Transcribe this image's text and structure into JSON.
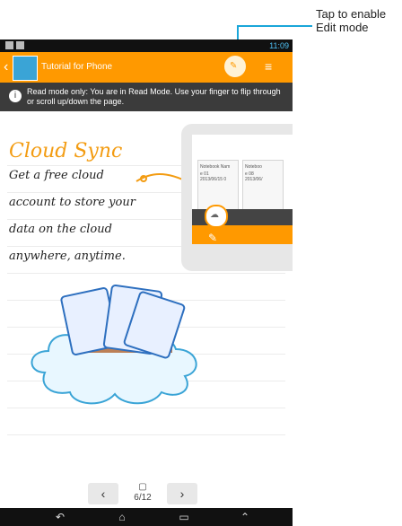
{
  "callout": {
    "text": "Tap to enable\nEdit mode"
  },
  "status_bar": {
    "time": "11:09"
  },
  "action_bar": {
    "title": "Tutorial for Phone"
  },
  "banner": {
    "text": "Read mode only: You are in Read Mode. Use your finger to flip through or scroll up/down the page."
  },
  "note": {
    "title": "Cloud Sync",
    "lines": [
      "Get a free cloud",
      "account to store your",
      "data on the cloud",
      "anywhere, anytime."
    ]
  },
  "card": {
    "notebook_1_title": "Notebook Nam",
    "notebook_1_meta": "e 01\n2013/06/15 0",
    "notebook_2_title": "Noteboo",
    "notebook_2_meta": "e 08\n2013/06/"
  },
  "pager": {
    "prev": "‹",
    "next": "›",
    "page": "6/12"
  },
  "nav": {
    "back_icon": "back-icon",
    "home_icon": "home-icon",
    "recent_icon": "recent-apps-icon",
    "up_icon": "up-icon"
  },
  "colors": {
    "accent": "#ff9900",
    "callout_line": "#1aa6d9"
  }
}
